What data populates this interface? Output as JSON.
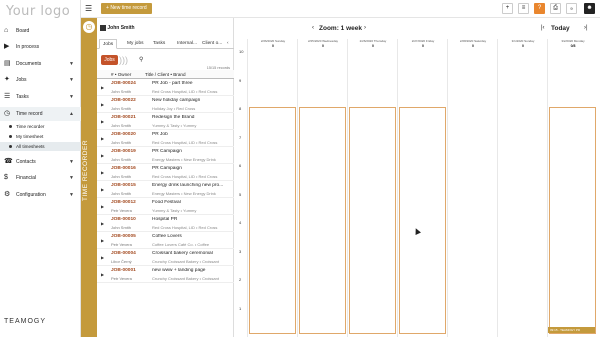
{
  "app": {
    "logo_text": "Your logo",
    "footer_logo": "TEAMOGY"
  },
  "topbar": {
    "new_time_record": "New time record",
    "notification_count": "9"
  },
  "sidebar": {
    "items": [
      {
        "label": "Board",
        "icon": "⌂"
      },
      {
        "label": "In process",
        "icon": "▶"
      },
      {
        "label": "Documents",
        "icon": "▤"
      },
      {
        "label": "Jobs",
        "icon": "✦"
      },
      {
        "label": "Tasks",
        "icon": "☰"
      },
      {
        "label": "Time record",
        "icon": "◷"
      },
      {
        "label": "Contacts",
        "icon": "☎"
      },
      {
        "label": "Financial",
        "icon": "$"
      },
      {
        "label": "Configuration",
        "icon": "⚙"
      }
    ],
    "sub_items": [
      "Time recorder",
      "My timesheet",
      "All timesheets"
    ]
  },
  "time_recorder": {
    "label": "TIME RECORDER"
  },
  "jobs_panel": {
    "user": "John Smith",
    "tabs": [
      "Jobs",
      "My jobs",
      "Tasks",
      "Internal...",
      "Client o..."
    ],
    "jobs_button": "Jobs",
    "records": "15/15 records",
    "col_owner": "# • Owner",
    "col_title": "Title / Client • Brand",
    "jobs": [
      {
        "id": "JOB-00024",
        "owner": "John Smith",
        "title": "PR Job - part three",
        "client": "Red Cross Hospital, LID • Red Cross"
      },
      {
        "id": "JOB-00022",
        "owner": "John Smith",
        "title": "New holiday campaign",
        "client": "Holiday Joy • Red Cross"
      },
      {
        "id": "JOB-00021",
        "owner": "John Smith",
        "title": "Redesign the Brand",
        "client": "Yummy & Tasty • Yummy"
      },
      {
        "id": "JOB-00020",
        "owner": "John Smith",
        "title": "PR Job",
        "client": "Red Cross Hospital, LID • Red Cross"
      },
      {
        "id": "JOB-00019",
        "owner": "John Smith",
        "title": "PR Campaign",
        "client": "Energy Masters • New Energy Drink"
      },
      {
        "id": "JOB-00016",
        "owner": "John Smith",
        "title": "PR Campaign",
        "client": "Red Cross Hospital, LID • Red Cross"
      },
      {
        "id": "JOB-00015",
        "owner": "John Smith",
        "title": "Energy drink launching new pro...",
        "client": "Energy Masters • New Energy Drink"
      },
      {
        "id": "JOB-00012",
        "owner": "Petr Vevera",
        "title": "Food Festival",
        "client": "Yummy & Tasty • Yummy"
      },
      {
        "id": "JOB-00010",
        "owner": "John Smith",
        "title": "Hospital PR",
        "client": "Red Cross Hospital, LID • Red Cross"
      },
      {
        "id": "JOB-00005",
        "owner": "Petr Vevera",
        "title": "Coffee Lovers",
        "client": "Coffee Lovers Café Co. • Coffee"
      },
      {
        "id": "JOB-00004",
        "owner": "Libor Černý",
        "title": "Croissant bakery ceremonial",
        "client": "Crunchy Croissant Bakery • Croissant"
      },
      {
        "id": "JOB-00001",
        "owner": "Petr Vevera",
        "title": "new www + landing page",
        "client": "Crunchy Croissant Bakery • Croissant"
      }
    ]
  },
  "calendar": {
    "zoom_label": "Zoom: 1 week",
    "today_label": "Today",
    "days": [
      {
        "date": "2/26/2020 Sunday",
        "hours": "0"
      },
      {
        "date": "2/25/2020 Wednesday",
        "hours": "0"
      },
      {
        "date": "2/26/2020 Thursday",
        "hours": "0"
      },
      {
        "date": "2/27/2020 Friday",
        "hours": "0"
      },
      {
        "date": "2/28/2020 Saturday",
        "hours": "0"
      },
      {
        "date": "3/1/2020 Sunday",
        "hours": "0"
      },
      {
        "date": "3/2/2020 Monday",
        "hours": "0/8"
      }
    ],
    "hours": [
      "10",
      "9",
      "8",
      "7",
      "6",
      "5",
      "4",
      "3",
      "2",
      "1"
    ],
    "entry_tag": "09:15 - TEAMOGY PR"
  }
}
